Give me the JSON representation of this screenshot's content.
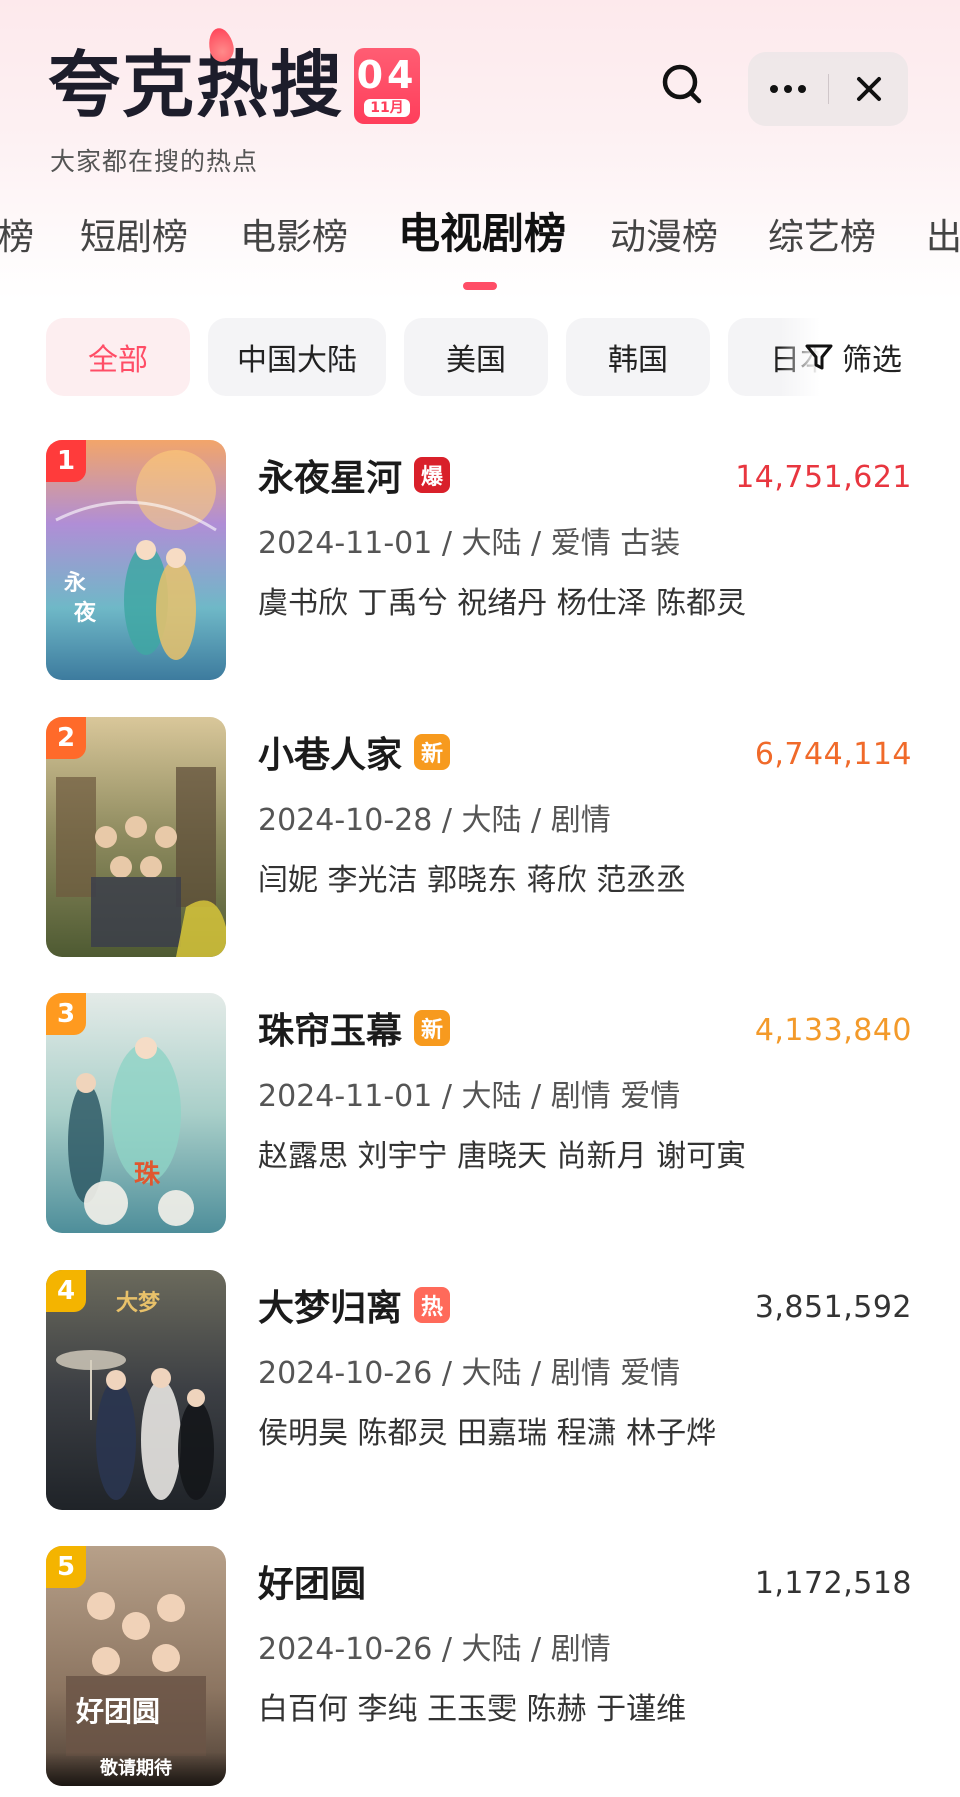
{
  "header": {
    "logo_text": "夸克热搜",
    "date_day": "04",
    "date_month": "11月",
    "subtitle": "大家都在搜的热点",
    "search_icon": "search-icon",
    "more_icon": "more-icon",
    "close_icon": "close-icon"
  },
  "tabs": [
    {
      "label": "榜"
    },
    {
      "label": "短剧榜"
    },
    {
      "label": "电影榜"
    },
    {
      "label": "电视剧榜"
    },
    {
      "label": "动漫榜"
    },
    {
      "label": "综艺榜"
    },
    {
      "label": "出"
    }
  ],
  "filters": [
    {
      "label": "全部"
    },
    {
      "label": "中国大陆"
    },
    {
      "label": "美国"
    },
    {
      "label": "韩国"
    },
    {
      "label": "日本"
    }
  ],
  "filter_button": {
    "label": "筛选",
    "icon": "filter-icon"
  },
  "items": [
    {
      "rank": "1",
      "title": "永夜星河",
      "tag": "爆",
      "tag_color": "#d9202a",
      "count": "14,751,621",
      "count_color": "#e8363f",
      "meta": "2024-11-01 / 大陆 / 爱情 古装",
      "cast": "虞书欣 丁禹兮 祝绪丹 杨仕泽 陈都灵",
      "rank_color": "#ff3b3b",
      "caption": ""
    },
    {
      "rank": "2",
      "title": "小巷人家",
      "tag": "新",
      "tag_color": "#f79a1e",
      "count": "6,744,114",
      "count_color": "#f06a2a",
      "meta": "2024-10-28 / 大陆 / 剧情",
      "cast": "闫妮 李光洁 郭晓东 蒋欣 范丞丞",
      "rank_color": "#ff6a2a",
      "caption": ""
    },
    {
      "rank": "3",
      "title": "珠帘玉幕",
      "tag": "新",
      "tag_color": "#f79a1e",
      "count": "4,133,840",
      "count_color": "#f39a2a",
      "meta": "2024-11-01 / 大陆 / 剧情 爱情",
      "cast": "赵露思 刘宇宁 唐晓天 尚新月 谢可寅",
      "rank_color": "#ff9a1f",
      "caption": ""
    },
    {
      "rank": "4",
      "title": "大梦归离",
      "tag": "热",
      "tag_color": "#ff6a5a",
      "count": "3,851,592",
      "count_color": "#333333",
      "meta": "2024-10-26 / 大陆 / 剧情 爱情",
      "cast": "侯明昊 陈都灵 田嘉瑞 程潇 林子烨",
      "rank_color": "#f4b400",
      "caption": ""
    },
    {
      "rank": "5",
      "title": "好团圆",
      "tag": "",
      "tag_color": "",
      "count": "1,172,518",
      "count_color": "#333333",
      "meta": "2024-10-26 / 大陆 / 剧情",
      "cast": "白百何 李纯 王玉雯 陈赫 于谨维",
      "rank_color": "#f4b400",
      "caption": "敬请期待"
    }
  ]
}
